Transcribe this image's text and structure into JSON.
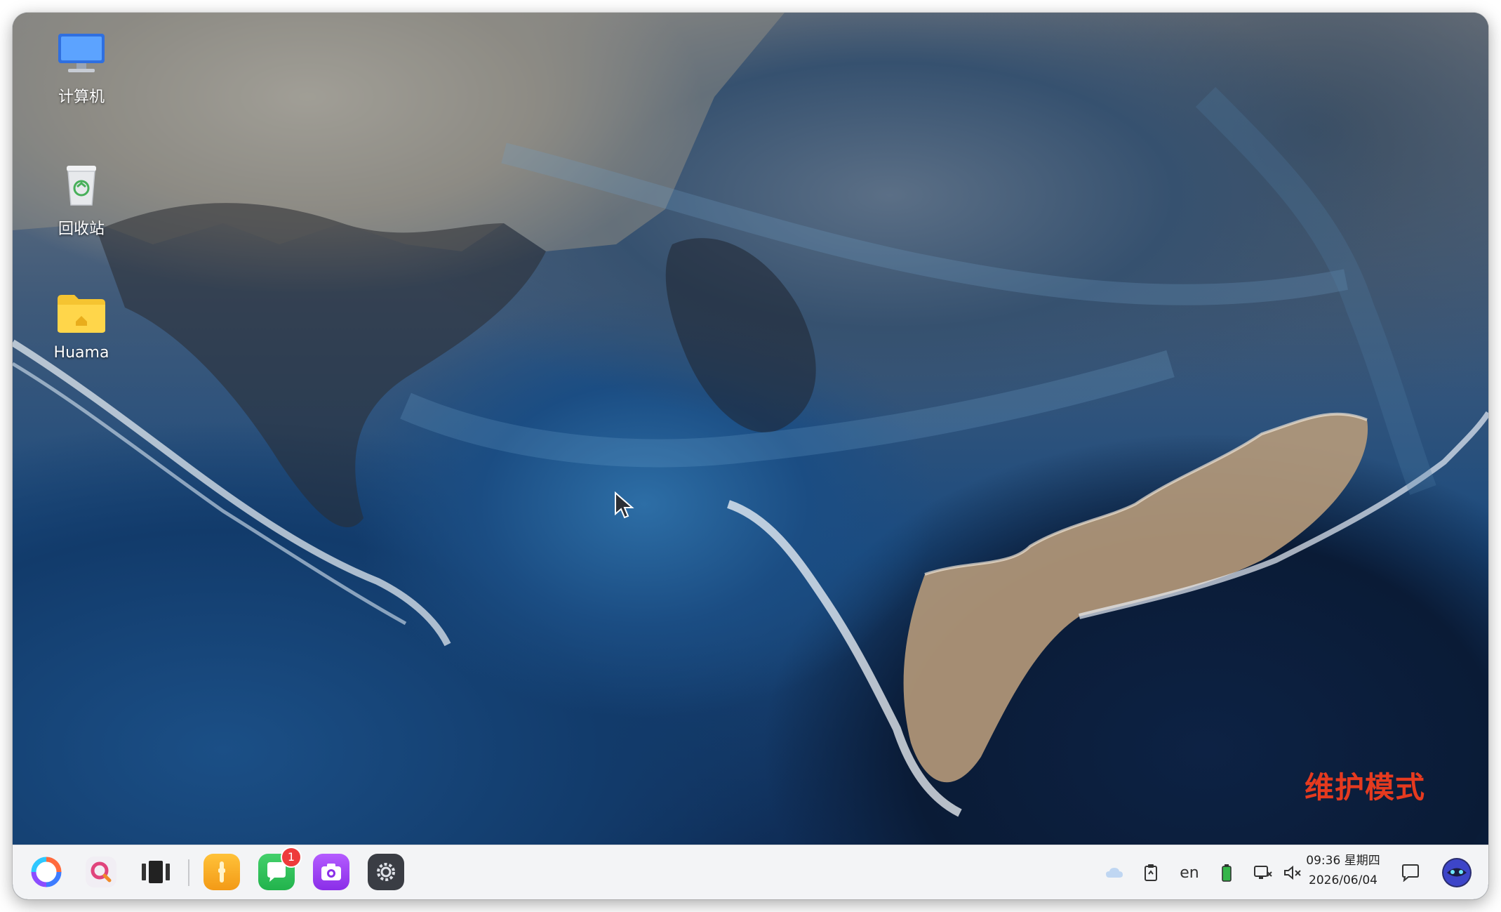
{
  "desktop": {
    "icons": [
      {
        "label": "计算机"
      },
      {
        "label": "回收站"
      },
      {
        "label": "Huama"
      }
    ],
    "watermark": "维护模式"
  },
  "taskbar": {
    "apps": [
      {
        "name": "launcher"
      },
      {
        "name": "search"
      },
      {
        "name": "multitask-view"
      },
      {
        "name": "file-manager"
      },
      {
        "name": "chat",
        "badge": "1"
      },
      {
        "name": "camera"
      },
      {
        "name": "settings"
      }
    ],
    "tray": {
      "input_method": "en",
      "time": "09:36 星期四",
      "date": "2026/06/04"
    }
  },
  "colors": {
    "watermark": "#e53a1f",
    "taskbar_bg": "#f3f4f6",
    "badge": "#ee3b3b"
  }
}
